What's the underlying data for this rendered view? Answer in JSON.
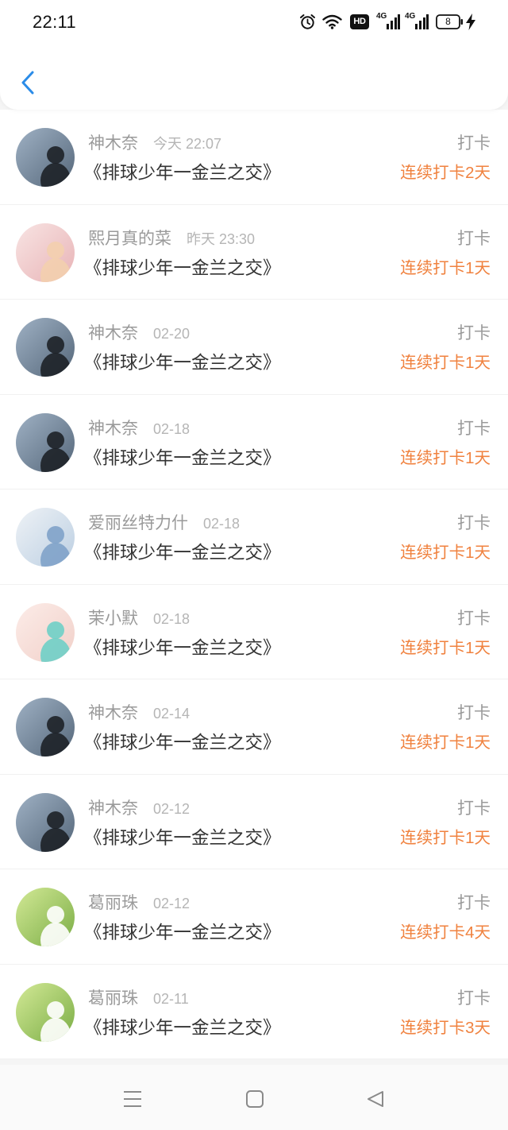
{
  "status_bar": {
    "time": "22:11",
    "hd_label": "HD",
    "network_1": "4G",
    "network_2": "4G",
    "battery_level": "8",
    "icons": [
      "alarm-icon",
      "wifi-icon",
      "hd-icon",
      "signal-icon",
      "signal-icon",
      "battery-icon",
      "charging-icon"
    ]
  },
  "header": {
    "back_icon": "chevron-left-icon"
  },
  "colors": {
    "accent": "#2b8ce8",
    "streak": "#f0823f",
    "name": "#9a9a9a",
    "time": "#b5b5b5",
    "title": "#333333",
    "icon": "#8a8a8a"
  },
  "checkins": [
    {
      "name": "神木奈",
      "time": "今天 22:07",
      "action": "打卡",
      "book": "《排球少年一金兰之交》",
      "streak": "连续打卡2天",
      "avatar": {
        "bg": [
          "#9fb1c4",
          "#55677a"
        ],
        "fg": "#1d2127"
      }
    },
    {
      "name": "熙月真的菜",
      "time": "昨天 23:30",
      "action": "打卡",
      "book": "《排球少年一金兰之交》",
      "streak": "连续打卡1天",
      "avatar": {
        "bg": [
          "#f8e4e3",
          "#e8b3b6"
        ],
        "fg": "#f3cfae"
      }
    },
    {
      "name": "神木奈",
      "time": "02-20",
      "action": "打卡",
      "book": "《排球少年一金兰之交》",
      "streak": "连续打卡1天",
      "avatar": {
        "bg": [
          "#9fb1c4",
          "#55677a"
        ],
        "fg": "#1d2127"
      }
    },
    {
      "name": "神木奈",
      "time": "02-18",
      "action": "打卡",
      "book": "《排球少年一金兰之交》",
      "streak": "连续打卡1天",
      "avatar": {
        "bg": [
          "#9fb1c4",
          "#55677a"
        ],
        "fg": "#1d2127"
      }
    },
    {
      "name": "爱丽丝特力什",
      "time": "02-18",
      "action": "打卡",
      "book": "《排球少年一金兰之交》",
      "streak": "连续打卡1天",
      "avatar": {
        "bg": [
          "#eef2f6",
          "#bccfe2"
        ],
        "fg": "#7fa2c9"
      }
    },
    {
      "name": "茉小默",
      "time": "02-18",
      "action": "打卡",
      "book": "《排球少年一金兰之交》",
      "streak": "连续打卡1天",
      "avatar": {
        "bg": [
          "#fcece8",
          "#f1d0c9"
        ],
        "fg": "#6fcfc6"
      }
    },
    {
      "name": "神木奈",
      "time": "02-14",
      "action": "打卡",
      "book": "《排球少年一金兰之交》",
      "streak": "连续打卡1天",
      "avatar": {
        "bg": [
          "#9fb1c4",
          "#55677a"
        ],
        "fg": "#1d2127"
      }
    },
    {
      "name": "神木奈",
      "time": "02-12",
      "action": "打卡",
      "book": "《排球少年一金兰之交》",
      "streak": "连续打卡1天",
      "avatar": {
        "bg": [
          "#9fb1c4",
          "#55677a"
        ],
        "fg": "#1d2127"
      }
    },
    {
      "name": "葛丽珠",
      "time": "02-12",
      "action": "打卡",
      "book": "《排球少年一金兰之交》",
      "streak": "连续打卡4天",
      "avatar": {
        "bg": [
          "#d3e996",
          "#7aad45"
        ],
        "fg": "#ffffff"
      }
    },
    {
      "name": "葛丽珠",
      "time": "02-11",
      "action": "打卡",
      "book": "《排球少年一金兰之交》",
      "streak": "连续打卡3天",
      "avatar": {
        "bg": [
          "#d3e996",
          "#7aad45"
        ],
        "fg": "#ffffff"
      }
    }
  ],
  "nav_bar": {
    "icons": [
      "menu-icon",
      "home-square-icon",
      "back-triangle-icon"
    ]
  }
}
